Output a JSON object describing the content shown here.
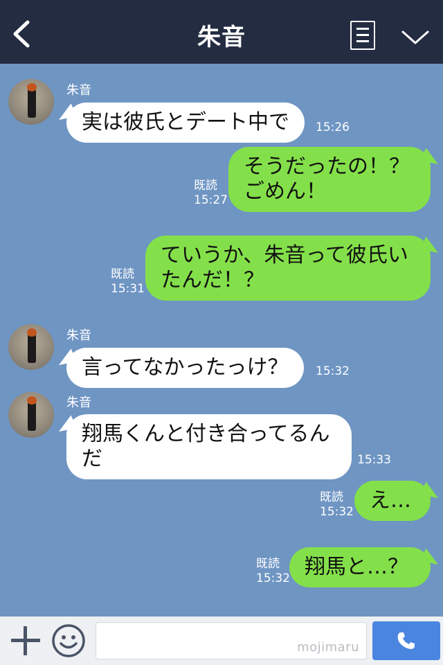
{
  "header": {
    "title": "朱音",
    "back_icon": "chevron-left-icon",
    "menu_icon": "menu-icon",
    "dropdown_icon": "chevron-down-icon",
    "background": "#242c42"
  },
  "chat": {
    "background": "#6f95c3",
    "incoming_bubble_color": "#ffffff",
    "outgoing_bubble_color": "#84e04a",
    "messages": [
      {
        "direction": "incoming",
        "sender": "朱音",
        "lines": [
          "実は彼氏とデート中で"
        ],
        "time": "15:26"
      },
      {
        "direction": "outgoing",
        "lines": [
          "そうだったの！？",
          "ごめん！"
        ],
        "read": "既読",
        "time": "15:27"
      },
      {
        "direction": "outgoing",
        "lines": [
          "ていうか、朱音って彼氏い",
          "たんだ！？"
        ],
        "read": "既読",
        "time": "15:31"
      },
      {
        "direction": "incoming",
        "sender": "朱音",
        "lines": [
          "言ってなかったっけ？"
        ],
        "time": "15:32"
      },
      {
        "direction": "incoming",
        "sender": "朱音",
        "lines": [
          "翔馬くんと付き合ってるん",
          "だ"
        ],
        "time": "15:33"
      },
      {
        "direction": "outgoing",
        "lines": [
          "え…"
        ],
        "read": "既読",
        "time": "15:32"
      },
      {
        "direction": "outgoing",
        "lines": [
          "翔馬と…？"
        ],
        "read": "既読",
        "time": "15:32"
      }
    ]
  },
  "input_bar": {
    "plus_icon": "plus-icon",
    "emoji_icon": "smiley-icon",
    "placeholder": "",
    "watermark": "mojimaru",
    "call_icon": "phone-icon",
    "call_button_color": "#4a86e0"
  }
}
